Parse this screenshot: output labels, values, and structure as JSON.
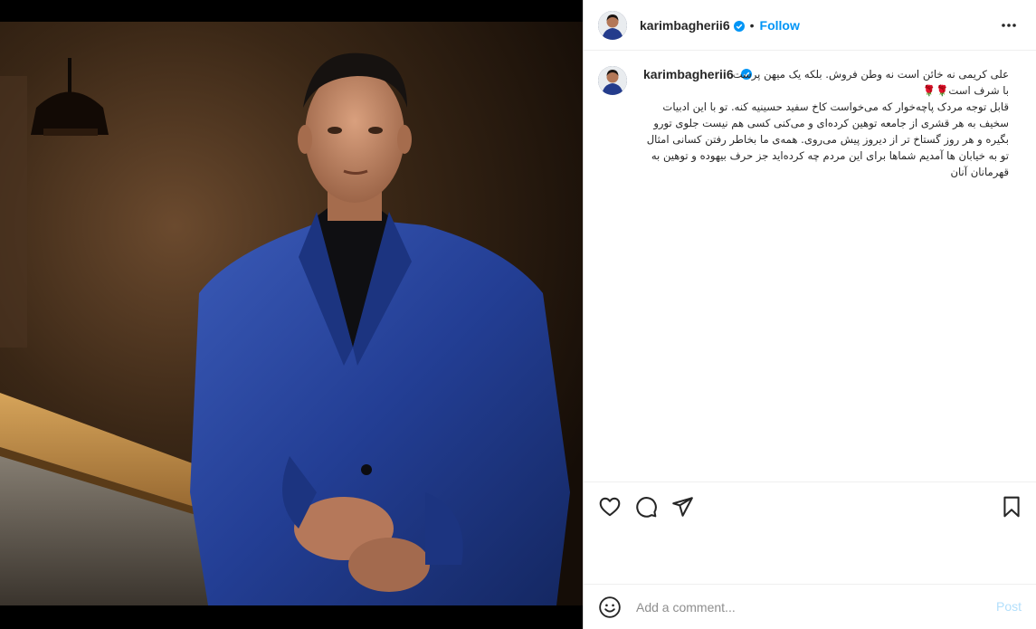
{
  "post": {
    "image_alt": "Man in blue suit leaning on a railing",
    "author": {
      "username": "karimbagherii6",
      "verified": true
    },
    "header": {
      "separator": "•",
      "follow_label": "Follow",
      "more_icon": "more-horizontal-icon"
    },
    "caption": {
      "username": "karimbagherii6",
      "lines": [
        "علی کریمی نه خائن است نه وطن فروش. بلکه یک میهن پرست",
        "با شرف است",
        "قابل توجه مردک پاچه‌خوار که می‌خواست کاخ سفید حسینیه کنه. تو با این ادبیات سخیف به هر قشری از جامعه توهین کرده‌ای و می‌کنی کسی هم نیست جلوی تورو بگیره و هر روز گستاخ تر از دیروز پیش می‌روی. همه‌ی ما بخاطر رفتن کسانی امثال تو به خیابان ها آمدیم شماها برای این مردم چه کرده‌اید جز حرف بیهوده و توهین به قهرمانان آنان"
      ],
      "roses": "🌹🌹"
    },
    "actions": {
      "like_icon": "heart-icon",
      "comment_icon": "comment-icon",
      "share_icon": "paper-plane-icon",
      "save_icon": "bookmark-icon"
    },
    "comment_box": {
      "emoji_icon": "smiley-icon",
      "placeholder": "Add a comment...",
      "post_label": "Post"
    }
  },
  "colors": {
    "accent": "#0095f6",
    "post_disabled": "#b2dffc",
    "text": "#262626",
    "muted": "#8e8e8e"
  }
}
